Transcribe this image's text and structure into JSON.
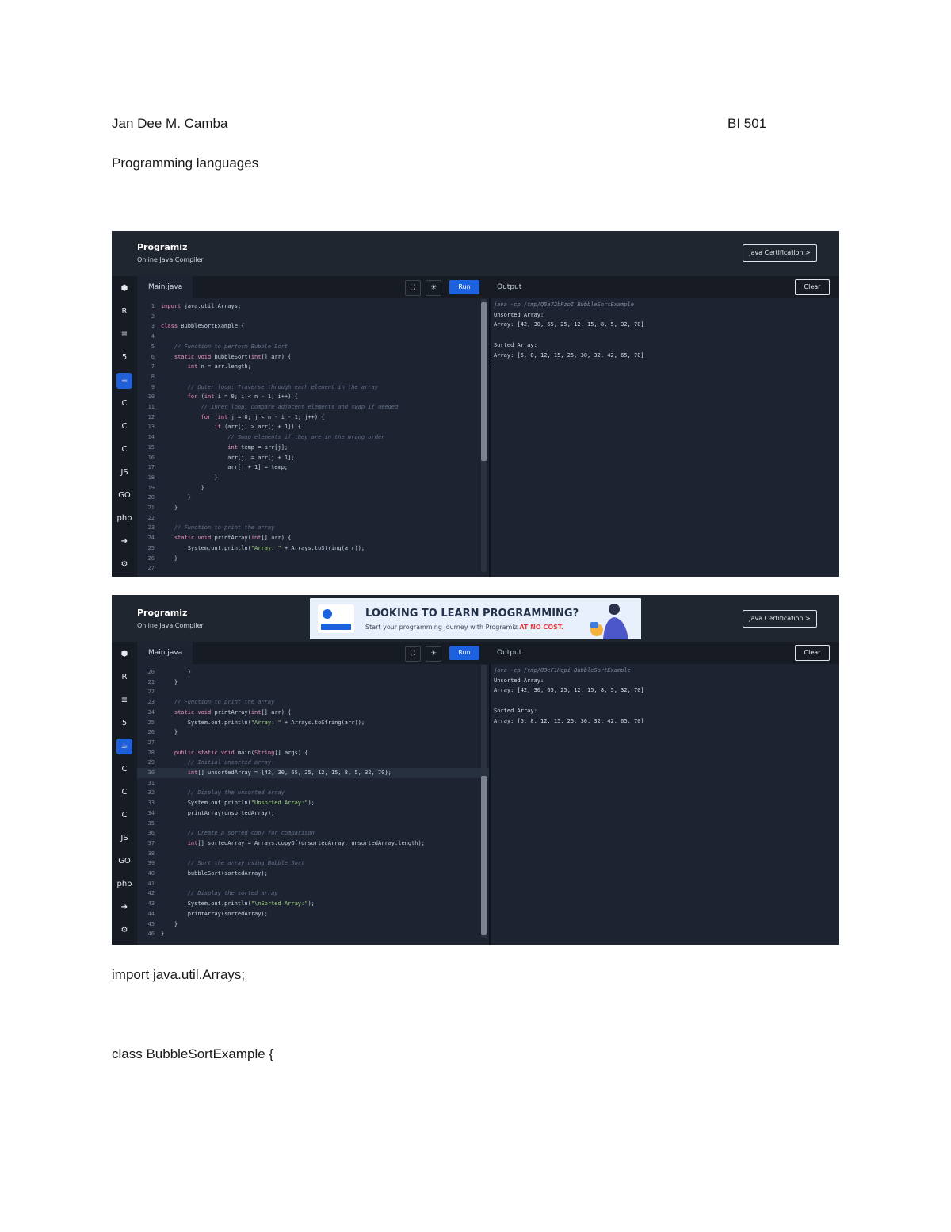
{
  "header": {
    "author": "Jan Dee M. Camba",
    "section": "BI 501",
    "subject": "Programming languages"
  },
  "compiler": {
    "brand": "Programiz",
    "subtitle": "Online Java Compiler",
    "cert_label": "Java Certification >",
    "file_tab": "Main.java",
    "run_label": "Run",
    "output_label": "Output",
    "clear_label": "Clear",
    "expand_icon": "⛶",
    "theme_icon": "☀"
  },
  "ad": {
    "title": "LOOKING TO LEARN PROGRAMMING?",
    "subtitle": "Start your programming journey with Programiz",
    "highlight": "AT NO COST."
  },
  "sidebar_icons": [
    {
      "name": "python-icon",
      "glyph": "⬢"
    },
    {
      "name": "r-icon",
      "glyph": "R"
    },
    {
      "name": "sql-icon",
      "glyph": "≣"
    },
    {
      "name": "html-icon",
      "glyph": "5"
    },
    {
      "name": "java-icon",
      "glyph": "☕"
    },
    {
      "name": "c-icon",
      "glyph": "C"
    },
    {
      "name": "cpp-icon",
      "glyph": "C"
    },
    {
      "name": "csharp-icon",
      "glyph": "C"
    },
    {
      "name": "js-icon",
      "glyph": "JS"
    },
    {
      "name": "go-icon",
      "glyph": "GO"
    },
    {
      "name": "php-icon",
      "glyph": "php"
    },
    {
      "name": "swift-icon",
      "glyph": "➔"
    },
    {
      "name": "rust-icon",
      "glyph": "⚙"
    }
  ],
  "shot1": {
    "code": [
      {
        "n": "1",
        "t": "import java.util.Arrays;"
      },
      {
        "n": "2",
        "t": ""
      },
      {
        "n": "3",
        "t": "class BubbleSortExample {"
      },
      {
        "n": "4",
        "t": ""
      },
      {
        "n": "5",
        "t": "    // Function to perform Bubble Sort"
      },
      {
        "n": "6",
        "t": "    static void bubbleSort(int[] arr) {"
      },
      {
        "n": "7",
        "t": "        int n = arr.length;"
      },
      {
        "n": "8",
        "t": ""
      },
      {
        "n": "9",
        "t": "        // Outer loop: Traverse through each element in the array"
      },
      {
        "n": "10",
        "t": "        for (int i = 0; i < n - 1; i++) {"
      },
      {
        "n": "11",
        "t": "            // Inner loop: Compare adjacent elements and swap if needed"
      },
      {
        "n": "12",
        "t": "            for (int j = 0; j < n - i - 1; j++) {"
      },
      {
        "n": "13",
        "t": "                if (arr[j] > arr[j + 1]) {"
      },
      {
        "n": "14",
        "t": "                    // Swap elements if they are in the wrong order"
      },
      {
        "n": "15",
        "t": "                    int temp = arr[j];"
      },
      {
        "n": "16",
        "t": "                    arr[j] = arr[j + 1];"
      },
      {
        "n": "17",
        "t": "                    arr[j + 1] = temp;"
      },
      {
        "n": "18",
        "t": "                }"
      },
      {
        "n": "19",
        "t": "            }"
      },
      {
        "n": "20",
        "t": "        }"
      },
      {
        "n": "21",
        "t": "    }"
      },
      {
        "n": "22",
        "t": ""
      },
      {
        "n": "23",
        "t": "    // Function to print the array"
      },
      {
        "n": "24",
        "t": "    static void printArray(int[] arr) {"
      },
      {
        "n": "25",
        "t": "        System.out.println(\"Array: \" + Arrays.toString(arr));"
      },
      {
        "n": "26",
        "t": "    }"
      },
      {
        "n": "27",
        "t": ""
      }
    ],
    "output": [
      {
        "t": "java -cp /tmp/Q5a72bPzoI BubbleSortExample",
        "cmd": true
      },
      {
        "t": "Unsorted Array:"
      },
      {
        "t": "Array: [42, 30, 65, 25, 12, 15, 8, 5, 32, 70]"
      },
      {
        "t": ""
      },
      {
        "t": "Sorted Array:"
      },
      {
        "t": "Array: [5, 8, 12, 15, 25, 30, 32, 42, 65, 70]"
      }
    ]
  },
  "shot2": {
    "code": [
      {
        "n": "20",
        "t": "        }"
      },
      {
        "n": "21",
        "t": "    }"
      },
      {
        "n": "22",
        "t": ""
      },
      {
        "n": "23",
        "t": "    // Function to print the array"
      },
      {
        "n": "24",
        "t": "    static void printArray(int[] arr) {"
      },
      {
        "n": "25",
        "t": "        System.out.println(\"Array: \" + Arrays.toString(arr));"
      },
      {
        "n": "26",
        "t": "    }"
      },
      {
        "n": "27",
        "t": ""
      },
      {
        "n": "28",
        "t": "    public static void main(String[] args) {"
      },
      {
        "n": "29",
        "t": "        // Initial unsorted array"
      },
      {
        "n": "30",
        "t": "        int[] unsortedArray = {42, 30, 65, 25, 12, 15, 8, 5, 32, 70};"
      },
      {
        "n": "31",
        "t": ""
      },
      {
        "n": "32",
        "t": "        // Display the unsorted array"
      },
      {
        "n": "33",
        "t": "        System.out.println(\"Unsorted Array:\");"
      },
      {
        "n": "34",
        "t": "        printArray(unsortedArray);"
      },
      {
        "n": "35",
        "t": ""
      },
      {
        "n": "36",
        "t": "        // Create a sorted copy for comparison"
      },
      {
        "n": "37",
        "t": "        int[] sortedArray = Arrays.copyOf(unsortedArray, unsortedArray.length);"
      },
      {
        "n": "38",
        "t": ""
      },
      {
        "n": "39",
        "t": "        // Sort the array using Bubble Sort"
      },
      {
        "n": "40",
        "t": "        bubbleSort(sortedArray);"
      },
      {
        "n": "41",
        "t": ""
      },
      {
        "n": "42",
        "t": "        // Display the sorted array"
      },
      {
        "n": "43",
        "t": "        System.out.println(\"\\nSorted Array:\");"
      },
      {
        "n": "44",
        "t": "        printArray(sortedArray);"
      },
      {
        "n": "45",
        "t": "    }"
      },
      {
        "n": "46",
        "t": "}"
      }
    ],
    "output": [
      {
        "t": "java -cp /tmp/O3eF1Hqpi BubbleSortExample",
        "cmd": true
      },
      {
        "t": "Unsorted Array:"
      },
      {
        "t": "Array: [42, 30, 65, 25, 12, 15, 8, 5, 32, 70]"
      },
      {
        "t": ""
      },
      {
        "t": "Sorted Array:"
      },
      {
        "t": "Array: [5, 8, 12, 15, 25, 30, 32, 42, 65, 70]"
      }
    ]
  },
  "body_text": {
    "line1": "import java.util.Arrays;",
    "line2": "class BubbleSortExample {"
  },
  "colors": {
    "keyword": "#f08fbf",
    "comment": "#64708a",
    "string": "#9fd27a",
    "accent": "#1c62e0"
  }
}
